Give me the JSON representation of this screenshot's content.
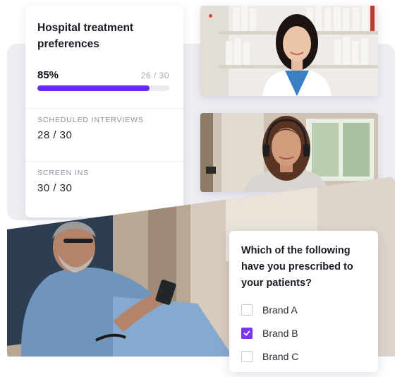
{
  "stats": {
    "title": "Hospital treatment preferences",
    "progress_percent_label": "85%",
    "progress_fraction": 0.85,
    "progress_count": "26 / 30",
    "metrics": [
      {
        "label": "SCHEDULED INTERVIEWS",
        "value": "28 / 30"
      },
      {
        "label": "SCREEN INS",
        "value": "30 / 30"
      }
    ]
  },
  "question": {
    "text": "Which of the following have you prescribed to your patients?",
    "options": [
      {
        "label": "Brand A",
        "checked": false
      },
      {
        "label": "Brand B",
        "checked": true
      },
      {
        "label": "Brand C",
        "checked": false
      }
    ]
  },
  "colors": {
    "accent": "#6a2cf0",
    "checkbox_accent": "#7b35ec",
    "recording": "#e2443b"
  }
}
